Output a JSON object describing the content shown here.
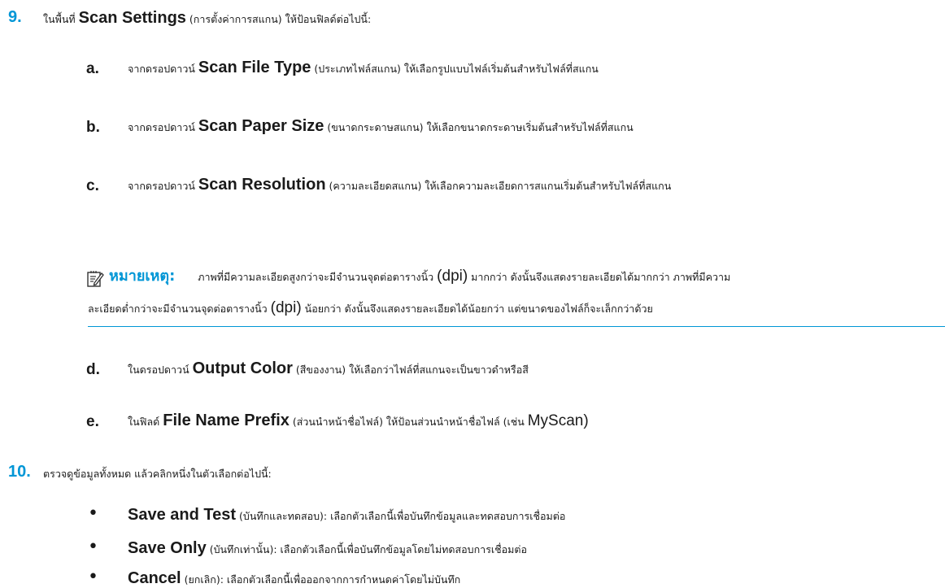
{
  "step9": {
    "number": "9.",
    "pre": "ในพื้นที่ ",
    "bold": "Scan Settings",
    "post": " (การตั้งค่าการสแกน) ให้ป้อนฟิลด์ต่อไปนี้:"
  },
  "sub_a": {
    "letter": "a.",
    "pre": "จากดรอปดาวน์ ",
    "bold": "Scan File Type",
    "post": " (ประเภทไฟล์สแกน) ให้เลือกรูปแบบไฟล์เริ่มต้นสำหรับไฟล์ที่สแกน"
  },
  "sub_b": {
    "letter": "b.",
    "pre": "จากดรอปดาวน์ ",
    "bold": "Scan Paper Size",
    "post": " (ขนาดกระดาษสแกน) ให้เลือกขนาดกระดาษเริ่มต้นสำหรับไฟล์ที่สแกน"
  },
  "sub_c": {
    "letter": "c.",
    "pre": "จากดรอปดาวน์ ",
    "bold": "Scan Resolution",
    "post": " (ความละเอียดสแกน) ให้เลือกความละเอียดการสแกนเริ่มต้นสำหรับไฟล์ที่สแกน"
  },
  "note": {
    "icon": "note-icon",
    "label": "หมายเหตุ:",
    "line1_a": "ภาพที่มีความละเอียดสูงกว่าจะมีจำนวนจุดต่อตารางนิ้ว ",
    "line1_dpi": "(dpi)",
    "line1_b": " มากกว่า ดังนั้นจึงแสดงรายละเอียดได้มากกว่า ภาพที่มีความ",
    "line2_a": "ละเอียดต่ำกว่าจะมีจำนวนจุดต่อตารางนิ้ว ",
    "line2_dpi": "(dpi)",
    "line2_b": " น้อยกว่า ดังนั้นจึงแสดงรายละเอียดได้น้อยกว่า แต่ขนาดของไฟล์ก็จะเล็กกว่าด้วย"
  },
  "sub_d": {
    "letter": "d.",
    "pre": "ในดรอปดาวน์ ",
    "bold": "Output Color",
    "post": " (สีของงาน) ให้เลือกว่าไฟล์ที่สแกนจะเป็นขาวดำหรือสี"
  },
  "sub_e": {
    "letter": "e.",
    "pre": "ในฟิลด์ ",
    "bold": "File Name Prefix",
    "post_a": " (ส่วนนำหน้าชื่อไฟล์) ให้ป้อนส่วนนำหน้าชื่อไฟล์ (เช่น ",
    "example": "MyScan",
    "post_b": ")"
  },
  "step10": {
    "number": "10.",
    "text": "ตรวจดูข้อมูลทั้งหมด แล้วคลิกหนึ่งในตัวเลือกต่อไปนี้:"
  },
  "options": [
    {
      "bullet": "•",
      "bold": "Save and Test",
      "post": " (บันทึกและทดสอบ): เลือกตัวเลือกนี้เพื่อบันทึกข้อมูลและทดสอบการเชื่อมต่อ"
    },
    {
      "bullet": "•",
      "bold": "Save Only",
      "post": " (บันทึกเท่านั้น): เลือกตัวเลือกนี้เพื่อบันทึกข้อมูลโดยไม่ทดสอบการเชื่อมต่อ"
    },
    {
      "bullet": "•",
      "bold": "Cancel",
      "post": " (ยกเลิก): เลือกตัวเลือกนี้เพื่อออกจากการกำหนดค่าโดยไม่บันทึก"
    }
  ],
  "colors": {
    "accent": "#0096d6",
    "text": "#1a1a1a"
  }
}
